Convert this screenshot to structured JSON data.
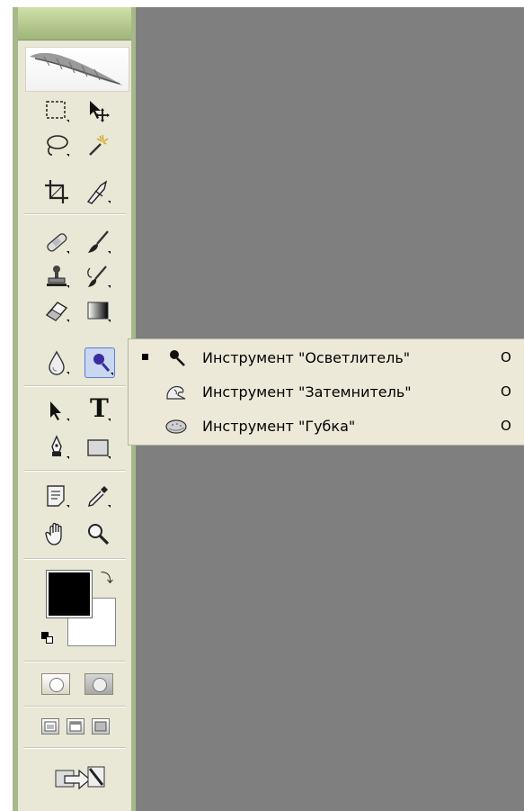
{
  "toolbox": {
    "tools": [
      {
        "name": "rectangular-marquee-tool",
        "icon": "marquee-icon"
      },
      {
        "name": "move-tool",
        "icon": "move-icon"
      },
      {
        "name": "lasso-tool",
        "icon": "lasso-icon"
      },
      {
        "name": "magic-wand-tool",
        "icon": "magic-wand-icon"
      },
      {
        "name": "crop-tool",
        "icon": "crop-icon"
      },
      {
        "name": "slice-tool",
        "icon": "slice-icon"
      },
      {
        "name": "healing-brush-tool",
        "icon": "bandage-icon"
      },
      {
        "name": "brush-tool",
        "icon": "brush-icon"
      },
      {
        "name": "clone-stamp-tool",
        "icon": "stamp-icon"
      },
      {
        "name": "history-brush-tool",
        "icon": "history-brush-icon"
      },
      {
        "name": "eraser-tool",
        "icon": "eraser-icon"
      },
      {
        "name": "gradient-tool",
        "icon": "gradient-icon"
      },
      {
        "name": "blur-tool",
        "icon": "drop-icon"
      },
      {
        "name": "dodge-tool",
        "icon": "dodge-icon"
      },
      {
        "name": "path-selection-tool",
        "icon": "arrow-icon"
      },
      {
        "name": "type-tool",
        "icon": "type-icon",
        "glyph": "T"
      },
      {
        "name": "pen-tool",
        "icon": "pen-icon"
      },
      {
        "name": "shape-tool",
        "icon": "rectangle-icon"
      },
      {
        "name": "notes-tool",
        "icon": "notes-icon"
      },
      {
        "name": "eyedropper-tool",
        "icon": "eyedropper-icon"
      },
      {
        "name": "hand-tool",
        "icon": "hand-icon"
      },
      {
        "name": "zoom-tool",
        "icon": "zoom-icon"
      }
    ],
    "colors": {
      "foreground": "#000000",
      "background": "#ffffff",
      "swap_glyph": "⤵"
    }
  },
  "flyout": {
    "items": [
      {
        "label": "Инструмент \"Осветлитель\"",
        "shortcut": "O",
        "selected": true,
        "icon": "dodge-icon"
      },
      {
        "label": "Инструмент \"Затемнитель\"",
        "shortcut": "O",
        "selected": false,
        "icon": "burn-icon"
      },
      {
        "label": "Инструмент \"Губка\"",
        "shortcut": "O",
        "selected": false,
        "icon": "sponge-icon"
      }
    ]
  },
  "theme": {
    "canvas_bg": "#7f7f7f",
    "toolbox_bg": "#e9e7d6",
    "frame": "#a6b88a",
    "active_tool": "#c9d7f0"
  }
}
